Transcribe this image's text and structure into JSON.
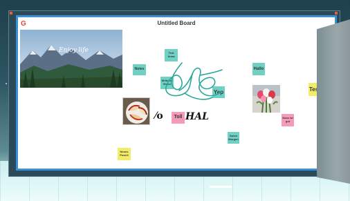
{
  "board": {
    "title": "Untitled Board",
    "logo_glyph": "G"
  },
  "images": {
    "mountain": {
      "caption": "Enjoy life"
    },
    "apples": {
      "subject": "sliced apples"
    },
    "tulips": {
      "subject": "tulip bouquet"
    }
  },
  "notes": {
    "notes": "Notes",
    "test_anna": "Test\nAnna",
    "write_on_shore": "Write on\nShore",
    "yep": "Yep",
    "hallo": "Hallo",
    "toll": "Toll",
    "dass_ist_gut": "Dass ist\ngut",
    "guten_morgen": "Guten\nMorgen",
    "neues_post_it": "Neues\nPost-It",
    "tes": "Tes"
  },
  "handwriting": {
    "scribble_glyph": "⁄o",
    "hal": "HAL"
  },
  "colors": {
    "board_border": "#3b8fd6",
    "note_teal": "#6fd0c4",
    "note_pink": "#f59bb8",
    "note_yellow": "#f2ec6a",
    "logo": "#e2452e"
  }
}
